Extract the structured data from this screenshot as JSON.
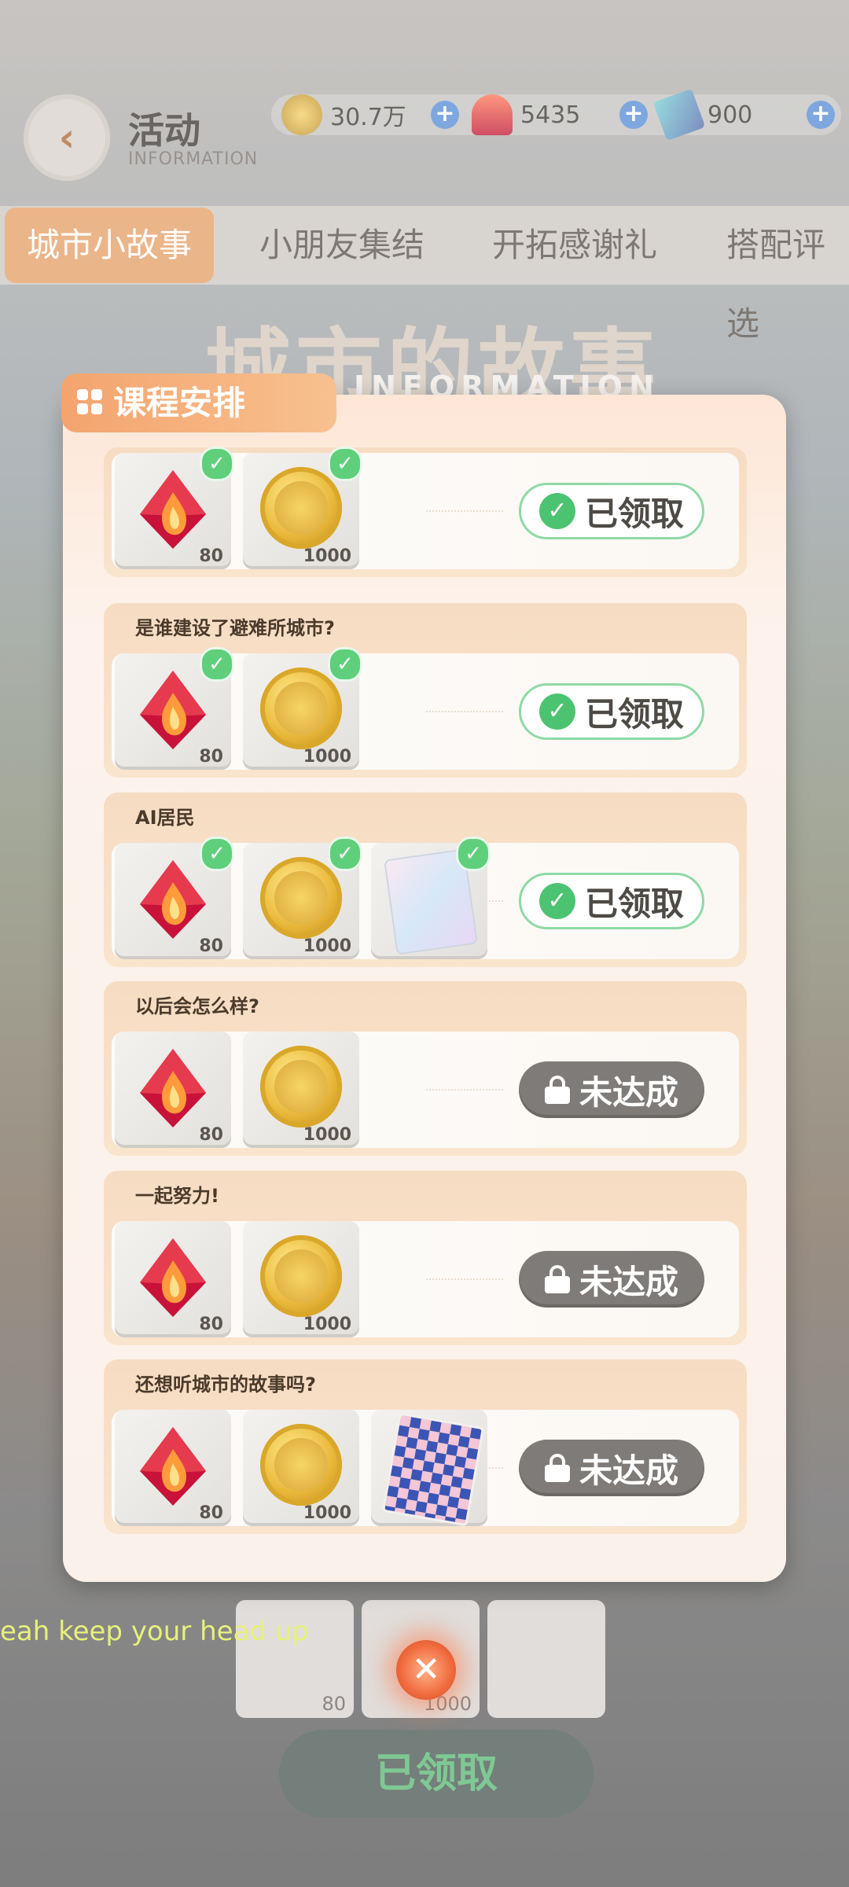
{
  "header": {
    "title": "活动",
    "subtitle": "INFORMATION",
    "currencies": [
      {
        "icon": "gold-coin-icon",
        "value": "30.7万"
      },
      {
        "icon": "red-crystal-icon",
        "value": "5435"
      },
      {
        "icon": "ticket-card-icon",
        "value": "900"
      }
    ]
  },
  "tabs": [
    {
      "label": "城市小故事",
      "active": true
    },
    {
      "label": "小朋友集结",
      "active": false
    },
    {
      "label": "开拓感谢礼",
      "active": false
    },
    {
      "label": "搭配评选",
      "active": false
    }
  ],
  "banner": {
    "title": "城市的故事",
    "subtitle": "INFORMATION"
  },
  "modal": {
    "tag": "课程安排",
    "items": [
      {
        "title": "",
        "rewards": [
          {
            "type": "crystal",
            "count": "80",
            "claimed": true
          },
          {
            "type": "coin",
            "count": "1000",
            "claimed": true
          }
        ],
        "status": "已领取",
        "done": true
      },
      {
        "title": "是谁建设了避难所城市?",
        "rewards": [
          {
            "type": "crystal",
            "count": "80",
            "claimed": true
          },
          {
            "type": "coin",
            "count": "1000",
            "claimed": true
          }
        ],
        "status": "已领取",
        "done": true
      },
      {
        "title": "AI居民",
        "rewards": [
          {
            "type": "crystal",
            "count": "80",
            "claimed": true
          },
          {
            "type": "coin",
            "count": "1000",
            "claimed": true
          },
          {
            "type": "card",
            "count": "",
            "claimed": true
          }
        ],
        "status": "已领取",
        "done": true
      },
      {
        "title": "以后会怎么样?",
        "rewards": [
          {
            "type": "crystal",
            "count": "80",
            "claimed": false
          },
          {
            "type": "coin",
            "count": "1000",
            "claimed": false
          }
        ],
        "status": "未达成",
        "done": false
      },
      {
        "title": "一起努力!",
        "rewards": [
          {
            "type": "crystal",
            "count": "80",
            "claimed": false
          },
          {
            "type": "coin",
            "count": "1000",
            "claimed": false
          }
        ],
        "status": "未达成",
        "done": false
      },
      {
        "title": "还想听城市的故事吗?",
        "rewards": [
          {
            "type": "crystal",
            "count": "80",
            "claimed": false
          },
          {
            "type": "coin",
            "count": "1000",
            "claimed": false
          },
          {
            "type": "checker",
            "count": "",
            "claimed": false
          }
        ],
        "status": "未达成",
        "done": false
      }
    ]
  },
  "background_rewards": {
    "crystal_count": "80",
    "coin_count": "1000",
    "claimed_button": "已领取"
  },
  "subtitle_overlay": "eah keep your head up",
  "colors": {
    "accent": "#f4a46e",
    "success": "#4cc371",
    "locked": "#7f7b78"
  }
}
